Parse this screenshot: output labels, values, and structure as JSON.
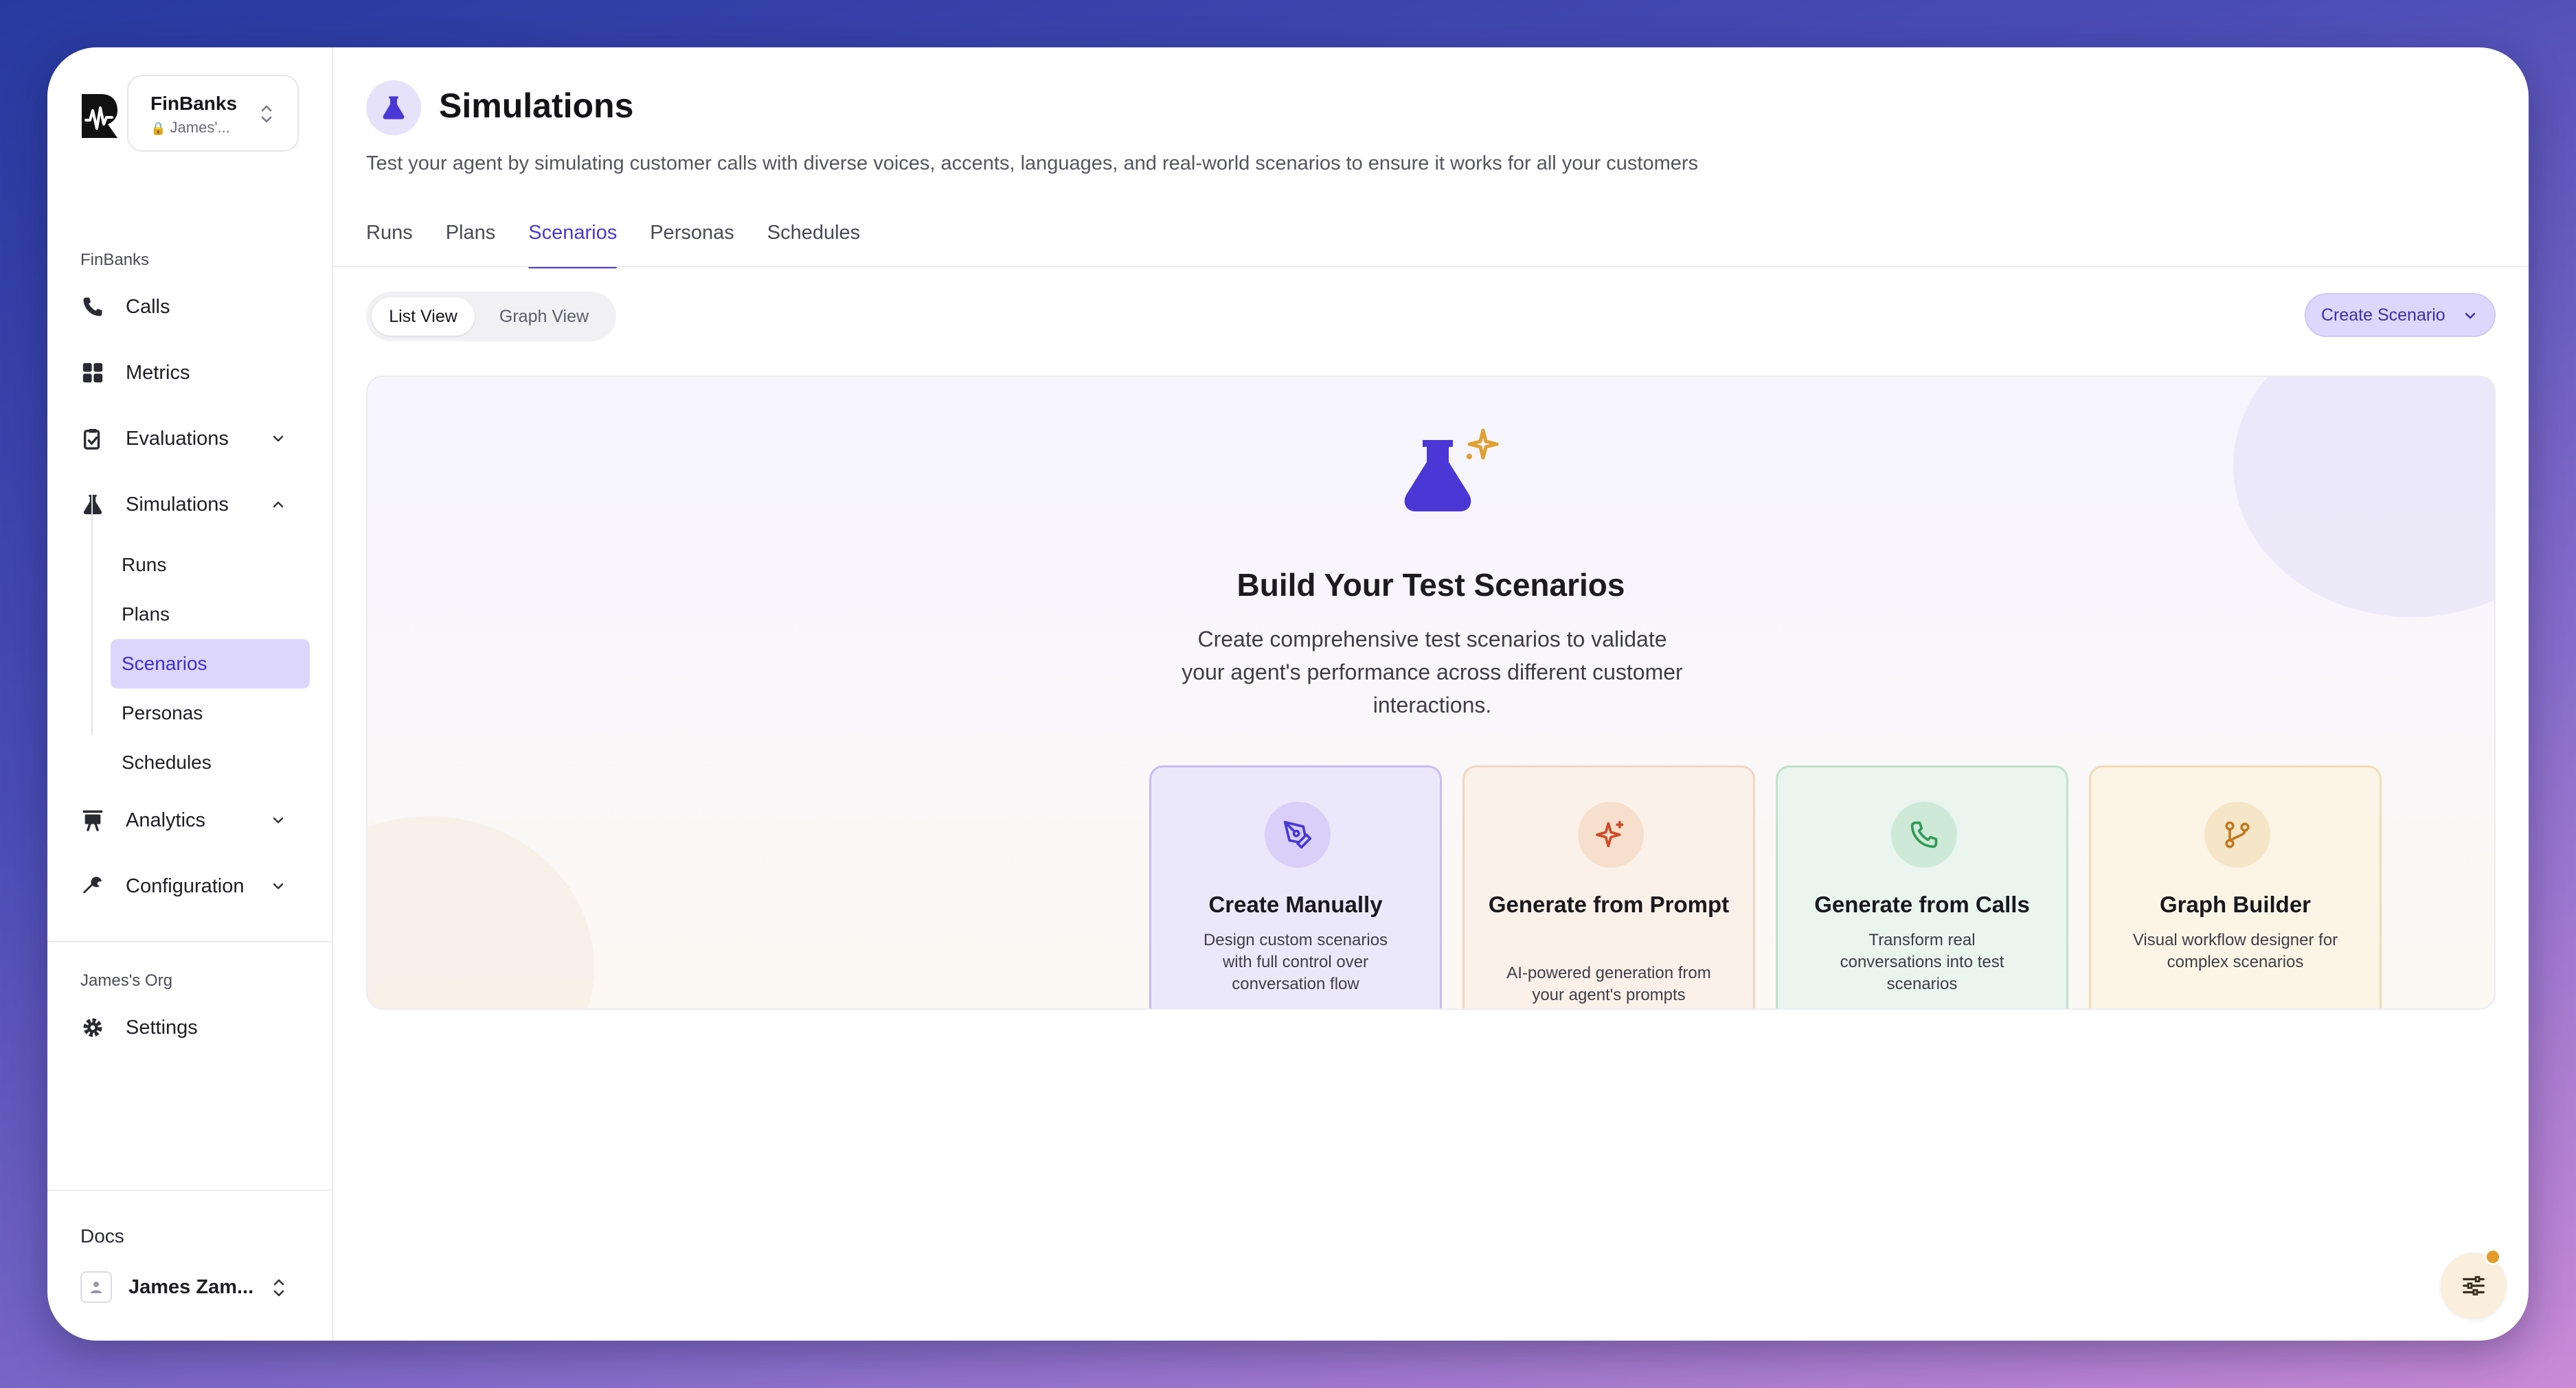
{
  "org": {
    "name": "FinBanks",
    "sub": "James'..."
  },
  "sidebar": {
    "section_label": "FinBanks",
    "items": [
      {
        "label": "Calls",
        "icon": "phone-icon"
      },
      {
        "label": "Metrics",
        "icon": "grid-icon"
      },
      {
        "label": "Evaluations",
        "icon": "clipboard-check-icon"
      },
      {
        "label": "Simulations",
        "icon": "flask-icon"
      }
    ],
    "sim_sub": [
      {
        "label": "Runs"
      },
      {
        "label": "Plans"
      },
      {
        "label": "Scenarios",
        "active": true
      },
      {
        "label": "Personas"
      },
      {
        "label": "Schedules"
      }
    ],
    "after_items": [
      {
        "label": "Analytics",
        "icon": "chart-icon"
      },
      {
        "label": "Configuration",
        "icon": "wrench-icon"
      }
    ],
    "org_label": "James's Org",
    "settings_label": "Settings",
    "docs_label": "Docs",
    "user_name": "James Zam..."
  },
  "header": {
    "title": "Simulations",
    "description": "Test your agent by simulating customer calls with diverse voices, accents, languages, and real-world scenarios to ensure it works for all your customers"
  },
  "tabs": [
    {
      "label": "Runs"
    },
    {
      "label": "Plans"
    },
    {
      "label": "Scenarios",
      "active": true
    },
    {
      "label": "Personas"
    },
    {
      "label": "Schedules"
    }
  ],
  "view_toggle": {
    "list": "List View",
    "graph": "Graph View"
  },
  "create_button": "Create Scenario",
  "empty_state": {
    "title": "Build Your Test Scenarios",
    "description": "Create comprehensive test scenarios to validate your agent's performance across different customer interactions."
  },
  "cards": [
    {
      "title": "Create Manually",
      "desc": "Design custom scenarios with full control over conversation flow",
      "icon": "pen-tool-icon"
    },
    {
      "title": "Generate from Prompt",
      "desc": "AI-powered generation from your agent's prompts",
      "icon": "sparkle-icon"
    },
    {
      "title": "Generate from Calls",
      "desc": "Transform real conversations into test scenarios",
      "icon": "phone-icon"
    },
    {
      "title": "Graph Builder",
      "desc": "Visual workflow designer for complex scenarios",
      "icon": "git-branch-icon"
    }
  ],
  "colors": {
    "accent": "#4a37d6",
    "active_bg": "#ddd6fb",
    "fab_dot": "#e59b2a"
  }
}
